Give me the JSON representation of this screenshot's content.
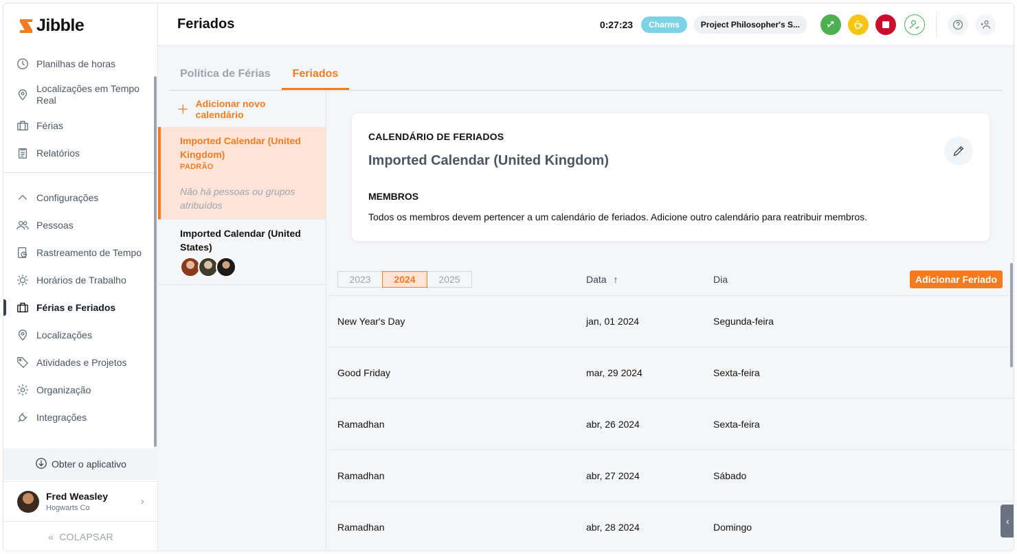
{
  "app": {
    "brand": "Jibble",
    "accent": "#f47b20"
  },
  "sidebar": {
    "items": [
      {
        "label": "Planilhas de horas",
        "icon": "clock-icon"
      },
      {
        "label": "Localizações em Tempo Real",
        "icon": "location-pin-icon"
      },
      {
        "label": "Férias",
        "icon": "briefcase-icon"
      },
      {
        "label": "Relatórios",
        "icon": "clipboard-icon"
      }
    ],
    "settings_label": "Configurações",
    "settings_items": [
      {
        "label": "Pessoas",
        "icon": "people-icon"
      },
      {
        "label": "Rastreamento de Tempo",
        "icon": "time-tracking-icon"
      },
      {
        "label": "Horários de Trabalho",
        "icon": "sun-icon"
      },
      {
        "label": "Férias e Feriados",
        "icon": "briefcase-icon",
        "active": true
      },
      {
        "label": "Localizações",
        "icon": "location-pin-icon"
      },
      {
        "label": "Atividades e Projetos",
        "icon": "tag-icon"
      },
      {
        "label": "Organização",
        "icon": "gear-icon"
      },
      {
        "label": "Integrações",
        "icon": "plug-icon"
      }
    ],
    "get_app": "Obter o aplicativo",
    "user": {
      "name": "Fred Weasley",
      "org": "Hogwarts Co"
    },
    "collapse": "COLAPSAR"
  },
  "header": {
    "title": "Feriados",
    "timer": "0:27:23",
    "activity": "Charms",
    "project": "Project Philosopher's S..."
  },
  "tabs": [
    {
      "label": "Política de Férias",
      "active": false
    },
    {
      "label": "Feriados",
      "active": true
    }
  ],
  "calendars": {
    "add_label": "Adicionar novo calendário",
    "items": [
      {
        "name": "Imported Calendar (United Kingdom)",
        "badge": "PADRÃO",
        "empty": "Não há pessoas ou grupos atribuídos"
      },
      {
        "name": "Imported Calendar (United States)"
      }
    ]
  },
  "detail": {
    "heading": "CALENDÁRIO DE FERIADOS",
    "name": "Imported Calendar (United Kingdom)",
    "members_heading": "MEMBROS",
    "members_desc": "Todos os membros devem pertencer a um calendário de feriados. Adicione outro calendário para reatribuir membros."
  },
  "table": {
    "years": [
      "2023",
      "2024",
      "2025"
    ],
    "selected_year": "2024",
    "col_date": "Data",
    "col_day": "Dia",
    "add_button": "Adicionar Feriado",
    "rows": [
      {
        "name": "New Year's Day",
        "date": "jan, 01 2024",
        "day": "Segunda-feira"
      },
      {
        "name": "Good Friday",
        "date": "mar, 29 2024",
        "day": "Sexta-feira"
      },
      {
        "name": "Ramadhan",
        "date": "abr, 26 2024",
        "day": "Sexta-feira"
      },
      {
        "name": "Ramadhan",
        "date": "abr, 27 2024",
        "day": "Sábado"
      },
      {
        "name": "Ramadhan",
        "date": "abr, 28 2024",
        "day": "Domingo"
      }
    ]
  }
}
